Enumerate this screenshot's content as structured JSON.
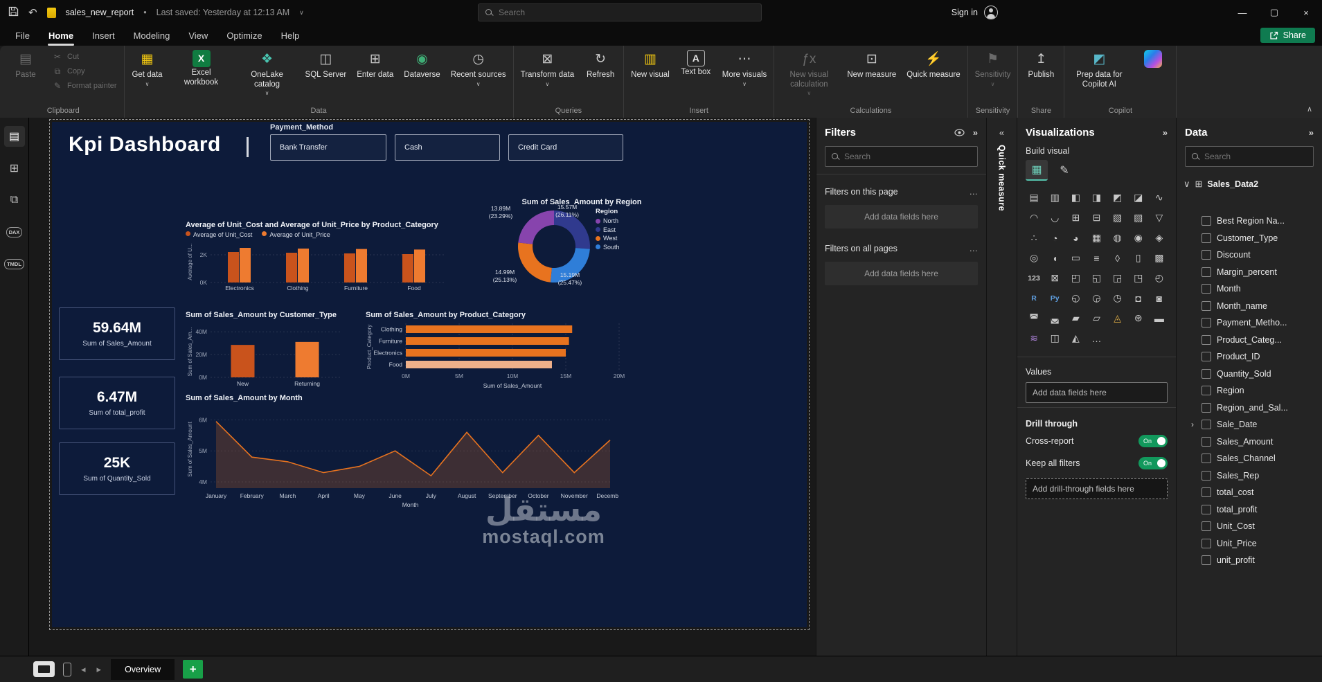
{
  "icons": {
    "undo": "↶",
    "caret": "∨",
    "chevron_down": "∨",
    "chevron_right": "›",
    "collapse_right": "»",
    "expand_left": "«",
    "ellipsis": "…",
    "minimize": "—",
    "maximize": "▢",
    "close": "×",
    "prev": "◂",
    "next": "▸",
    "collapse_ribbon": "∧",
    "eye": "◉"
  },
  "titlebar": {
    "document_name": "sales_new_report",
    "separator": "•",
    "last_saved": "Last saved: Yesterday at 12:13 AM",
    "search_placeholder": "Search",
    "sign_in": "Sign in"
  },
  "menu": {
    "items": [
      "File",
      "Home",
      "Insert",
      "Modeling",
      "View",
      "Optimize",
      "Help"
    ],
    "active": "Home",
    "share_label": "Share"
  },
  "ribbon": {
    "groups": [
      {
        "label": "Clipboard",
        "big": [
          {
            "name": "paste",
            "label": "Paste",
            "glyph": "▤",
            "disabled": true
          }
        ],
        "small": [
          {
            "name": "cut",
            "label": "Cut",
            "glyph": "✂",
            "disabled": true
          },
          {
            "name": "copy",
            "label": "Copy",
            "glyph": "⧉",
            "disabled": true
          },
          {
            "name": "format-painter",
            "label": "Format painter",
            "glyph": "✎",
            "disabled": true
          }
        ]
      },
      {
        "label": "Data",
        "big": [
          {
            "name": "get-data",
            "label": "Get data",
            "glyph": "▦",
            "color": "#f2c811",
            "caret": true
          },
          {
            "name": "excel-workbook",
            "label": "Excel workbook",
            "glyph": "X",
            "bg": "#107c41",
            "color": "#ffffff"
          },
          {
            "name": "onelake-catalog",
            "label": "OneLake catalog",
            "glyph": "❖",
            "color": "#49c5b1",
            "caret": true
          },
          {
            "name": "sql-server",
            "label": "SQL Server",
            "glyph": "◫",
            "color": "#c9c9c9"
          },
          {
            "name": "enter-data",
            "label": "Enter data",
            "glyph": "⊞",
            "color": "#c9c9c9"
          },
          {
            "name": "dataverse",
            "label": "Dataverse",
            "glyph": "◉",
            "color": "#3fae76"
          },
          {
            "name": "recent-sources",
            "label": "Recent sources",
            "glyph": "◷",
            "color": "#c9c9c9",
            "caret": true
          }
        ]
      },
      {
        "label": "Queries",
        "big": [
          {
            "name": "transform-data",
            "label": "Transform data",
            "glyph": "⊠",
            "color": "#c9c9c9",
            "caret": true
          },
          {
            "name": "refresh",
            "label": "Refresh",
            "glyph": "↻",
            "color": "#c9c9c9"
          }
        ]
      },
      {
        "label": "Insert",
        "big": [
          {
            "name": "new-visual",
            "label": "New visual",
            "glyph": "▥",
            "color": "#f2c811"
          },
          {
            "name": "text-box",
            "label": "Text box",
            "glyph": "A",
            "boxed": true,
            "color": "#e6e6e6"
          },
          {
            "name": "more-visuals",
            "label": "More visuals",
            "glyph": "⋯",
            "color": "#c9c9c9",
            "caret": true
          }
        ]
      },
      {
        "label": "Calculations",
        "big": [
          {
            "name": "new-visual-calculation",
            "label": "New visual calculation",
            "glyph": "ƒx",
            "disabled": true,
            "caret": true
          },
          {
            "name": "new-measure",
            "label": "New measure",
            "glyph": "⊡",
            "color": "#c9c9c9"
          },
          {
            "name": "quick-measure",
            "label": "Quick measure",
            "glyph": "⚡",
            "color": "#f2c811"
          }
        ]
      },
      {
        "label": "Sensitivity",
        "big": [
          {
            "name": "sensitivity",
            "label": "Sensitivity",
            "glyph": "⚑",
            "disabled": true,
            "caret": true
          }
        ]
      },
      {
        "label": "Share",
        "big": [
          {
            "name": "publish",
            "label": "Publish",
            "glyph": "↥",
            "color": "#c9c9c9"
          }
        ]
      },
      {
        "label": "Copilot",
        "big": [
          {
            "name": "prep-data-for-copilot-ai",
            "label": "Prep data for Copilot AI",
            "glyph": "◩",
            "color": "#58b7c9"
          },
          {
            "name": "copilot",
            "label": "",
            "gradient": true
          }
        ]
      }
    ]
  },
  "rail": {
    "items": [
      {
        "name": "report-view",
        "glyph": "▤",
        "active": true
      },
      {
        "name": "table-view",
        "glyph": "⊞"
      },
      {
        "name": "model-view",
        "glyph": "⧉"
      },
      {
        "name": "dax-query-view",
        "text": "DAX"
      },
      {
        "name": "tmdl-view",
        "text": "TMDL"
      }
    ]
  },
  "dashboard": {
    "title": "Kpi Dashboard",
    "slicer": {
      "field": "Payment_Method",
      "options": [
        "Bank Transfer",
        "Cash",
        "Credit Card"
      ],
      "widths": [
        168,
        152,
        166
      ]
    },
    "kpis": [
      {
        "value": "59.64M",
        "label": "Sum of Sales_Amount"
      },
      {
        "value": "6.47M",
        "label": "Sum of total_profit"
      },
      {
        "value": "25K",
        "label": "Sum of Quantity_Sold"
      }
    ],
    "watermark": {
      "arabic": "مستقل",
      "domain": "mostaql.com"
    }
  },
  "chart_data": [
    {
      "type": "bar",
      "title": "Average of Unit_Cost and Average of Unit_Price by Product_Category",
      "categories": [
        "Electronics",
        "Clothing",
        "Furniture",
        "Food"
      ],
      "series": [
        {
          "name": "Average of Unit_Cost",
          "color": "#c9531c",
          "values": [
            2.2,
            2.15,
            2.1,
            2.05
          ]
        },
        {
          "name": "Average of Unit_Price",
          "color": "#ee7b30",
          "values": [
            2.5,
            2.45,
            2.42,
            2.38
          ]
        }
      ],
      "ylabel": "Average of U...",
      "ylim": [
        0,
        3
      ],
      "yticks": [
        {
          "v": 0,
          "label": "0K"
        },
        {
          "v": 2,
          "label": "2K"
        }
      ],
      "legend_position": "top",
      "grid": true
    },
    {
      "type": "pie",
      "title": "Sum of Sales_Amount by Region",
      "legend_title": "Region",
      "legend_position": "right",
      "slices": [
        {
          "name": "East",
          "value_m": 15.57,
          "pct": 26.11,
          "l1": "15.57M",
          "l2": "(26.11%)",
          "color": "#303a8e"
        },
        {
          "name": "South",
          "value_m": 15.19,
          "pct": 25.47,
          "l1": "15.19M",
          "l2": "(25.47%)",
          "color": "#2f7ed8"
        },
        {
          "name": "West",
          "value_m": 14.99,
          "pct": 25.13,
          "l1": "14.99M",
          "l2": "(25.13%)",
          "color": "#e8731f"
        },
        {
          "name": "North",
          "value_m": 13.89,
          "pct": 23.29,
          "l1": "13.89M",
          "l2": "(23.29%)",
          "color": "#8744ad"
        }
      ],
      "legend": [
        {
          "name": "North",
          "color": "#8744ad"
        },
        {
          "name": "East",
          "color": "#303a8e"
        },
        {
          "name": "West",
          "color": "#e8731f"
        },
        {
          "name": "South",
          "color": "#2f7ed8"
        }
      ]
    },
    {
      "type": "bar",
      "title": "Sum of Sales_Amount by Customer_Type",
      "categories": [
        "New",
        "Returning"
      ],
      "values": [
        28.5,
        31.1
      ],
      "colors": [
        "#c9531c",
        "#ee7b30"
      ],
      "ylabel": "Sum of Sales_Am...",
      "ylim": [
        0,
        45
      ],
      "yticks": [
        {
          "v": 0,
          "label": "0M"
        },
        {
          "v": 20,
          "label": "20M"
        },
        {
          "v": 40,
          "label": "40M"
        }
      ],
      "grid": true
    },
    {
      "type": "hbar",
      "title": "Sum of Sales_Amount by Product_Category",
      "categories": [
        "Clothing",
        "Furniture",
        "Electronics",
        "Food"
      ],
      "values": [
        15.6,
        15.3,
        15.0,
        13.7
      ],
      "colors": [
        "#e8731f",
        "#e8731f",
        "#e8731f",
        "#eeb08a"
      ],
      "xlabel": "Sum of Sales_Amount",
      "ylabel": "Product_Category",
      "xlim": [
        0,
        20
      ],
      "xticks": [
        {
          "v": 0,
          "label": "0M"
        },
        {
          "v": 5,
          "label": "5M"
        },
        {
          "v": 10,
          "label": "10M"
        },
        {
          "v": 15,
          "label": "15M"
        },
        {
          "v": 20,
          "label": "20M"
        }
      ],
      "grid": true
    },
    {
      "type": "area",
      "title": "Sum of Sales_Amount by Month",
      "categories": [
        "January",
        "February",
        "March",
        "April",
        "May",
        "June",
        "July",
        "August",
        "September",
        "October",
        "November",
        "December"
      ],
      "values": [
        5.95,
        4.8,
        4.65,
        4.3,
        4.5,
        5.0,
        4.2,
        5.6,
        4.3,
        5.5,
        4.3,
        5.35
      ],
      "line_color": "#e8731f",
      "fill_color": "rgba(232,115,31,0.22)",
      "xlabel": "Month",
      "ylabel": "Sum of Sales_Amount",
      "ylim": [
        3.8,
        6.3
      ],
      "yticks": [
        {
          "v": 4,
          "label": "4M"
        },
        {
          "v": 5,
          "label": "5M"
        },
        {
          "v": 6,
          "label": "6M"
        }
      ],
      "grid": true
    }
  ],
  "filters": {
    "title": "Filters",
    "search_placeholder": "Search",
    "sections": [
      {
        "label": "Filters on this page",
        "placeholder": "Add data fields here"
      },
      {
        "label": "Filters on all pages",
        "placeholder": "Add data fields here"
      }
    ]
  },
  "quick_measure": {
    "label": "Quick measure"
  },
  "visualizations": {
    "title": "Visualizations",
    "build_label": "Build visual",
    "values_label": "Values",
    "add_fields_placeholder": "Add data fields here",
    "drill_through_label": "Drill through",
    "cross_report_label": "Cross-report",
    "keep_filters_label": "Keep all filters",
    "toggle_on_label": "On",
    "add_drill_placeholder": "Add drill-through fields here",
    "gallery": [
      {
        "name": "stacked-bar-chart",
        "glyph": "▤"
      },
      {
        "name": "stacked-column-chart",
        "glyph": "▥"
      },
      {
        "name": "clustered-bar-chart",
        "glyph": "◧"
      },
      {
        "name": "clustered-column-chart",
        "glyph": "◨"
      },
      {
        "name": "100-stacked-bar-chart",
        "glyph": "◩"
      },
      {
        "name": "100-stacked-column-chart",
        "glyph": "◪"
      },
      {
        "name": "line-chart",
        "glyph": "∿"
      },
      {
        "name": "area-chart",
        "glyph": "◠"
      },
      {
        "name": "stacked-area-chart",
        "glyph": "◡"
      },
      {
        "name": "line-and-stacked-column-chart",
        "glyph": "⊞"
      },
      {
        "name": "line-and-clustered-column-chart",
        "glyph": "⊟"
      },
      {
        "name": "ribbon-chart",
        "glyph": "▧"
      },
      {
        "name": "waterfall-chart",
        "glyph": "▨"
      },
      {
        "name": "funnel-chart",
        "glyph": "▽"
      },
      {
        "name": "scatter-chart",
        "glyph": "∴"
      },
      {
        "name": "pie-chart",
        "glyph": "◔"
      },
      {
        "name": "donut-chart",
        "glyph": "◕"
      },
      {
        "name": "treemap",
        "glyph": "▦"
      },
      {
        "name": "map",
        "glyph": "◍"
      },
      {
        "name": "filled-map",
        "glyph": "◉"
      },
      {
        "name": "shape-map",
        "glyph": "◈"
      },
      {
        "name": "azure-map",
        "glyph": "◎"
      },
      {
        "name": "gauge",
        "glyph": "◖"
      },
      {
        "name": "card",
        "glyph": "▭"
      },
      {
        "name": "multi-row-card",
        "glyph": "≡"
      },
      {
        "name": "kpi",
        "glyph": "◊"
      },
      {
        "name": "slicer",
        "glyph": "▯"
      },
      {
        "name": "table",
        "glyph": "▩"
      },
      {
        "name": "numeric-card",
        "glyph": "123",
        "text": true
      },
      {
        "name": "matrix",
        "glyph": "⊠"
      },
      {
        "name": "paginated-report",
        "glyph": "◰"
      },
      {
        "name": "power-apps",
        "glyph": "◱"
      },
      {
        "name": "power-automate",
        "glyph": "◲"
      },
      {
        "name": "metrics",
        "glyph": "◳"
      },
      {
        "name": "q-and-a",
        "glyph": "◴"
      },
      {
        "name": "r-script-visual",
        "glyph": "R",
        "text": true,
        "color": "#5f9fe0"
      },
      {
        "name": "python-visual",
        "glyph": "Py",
        "text": true,
        "color": "#5f9fe0"
      },
      {
        "name": "key-influencers",
        "glyph": "◵"
      },
      {
        "name": "decomposition-tree",
        "glyph": "◶"
      },
      {
        "name": "smart-narrative",
        "glyph": "◷"
      },
      {
        "name": "arcgis-map",
        "glyph": "◘"
      },
      {
        "name": "scorecard",
        "glyph": "◙"
      },
      {
        "name": "bookmark-navigator",
        "glyph": "◚"
      },
      {
        "name": "page-navigator",
        "glyph": "◛"
      },
      {
        "name": "button-slicer",
        "glyph": "▰"
      },
      {
        "name": "text-slicer",
        "glyph": "▱"
      },
      {
        "name": "accent-bar",
        "glyph": "◬",
        "color": "#d9a945"
      },
      {
        "name": "radar-chart",
        "glyph": "⊛"
      },
      {
        "name": "gantt-chart",
        "glyph": "▬"
      },
      {
        "name": "sankey-chart",
        "glyph": "≋",
        "color": "#b084dd"
      },
      {
        "name": "histogram",
        "glyph": "◫"
      },
      {
        "name": "tornado-chart",
        "glyph": "◭"
      },
      {
        "name": "get-more-visuals",
        "glyph": "…"
      }
    ]
  },
  "data_pane": {
    "title": "Data",
    "search_placeholder": "Search",
    "table": {
      "name": "Sales_Data2",
      "fields": [
        {
          "label": "Best Region Na..."
        },
        {
          "label": "Customer_Type"
        },
        {
          "label": "Discount"
        },
        {
          "label": "Margin_percent"
        },
        {
          "label": "Month"
        },
        {
          "label": "Month_name"
        },
        {
          "label": "Payment_Metho..."
        },
        {
          "label": "Product_Categ..."
        },
        {
          "label": "Product_ID"
        },
        {
          "label": "Quantity_Sold"
        },
        {
          "label": "Region"
        },
        {
          "label": "Region_and_Sal..."
        },
        {
          "label": "Sale_Date",
          "expandable": true
        },
        {
          "label": "Sales_Amount"
        },
        {
          "label": "Sales_Channel"
        },
        {
          "label": "Sales_Rep"
        },
        {
          "label": "total_cost"
        },
        {
          "label": "total_profit"
        },
        {
          "label": "Unit_Cost"
        },
        {
          "label": "Unit_Price"
        },
        {
          "label": "unit_profit"
        }
      ]
    }
  },
  "bottombar": {
    "page_tab": "Overview",
    "new_page_label": "+"
  }
}
